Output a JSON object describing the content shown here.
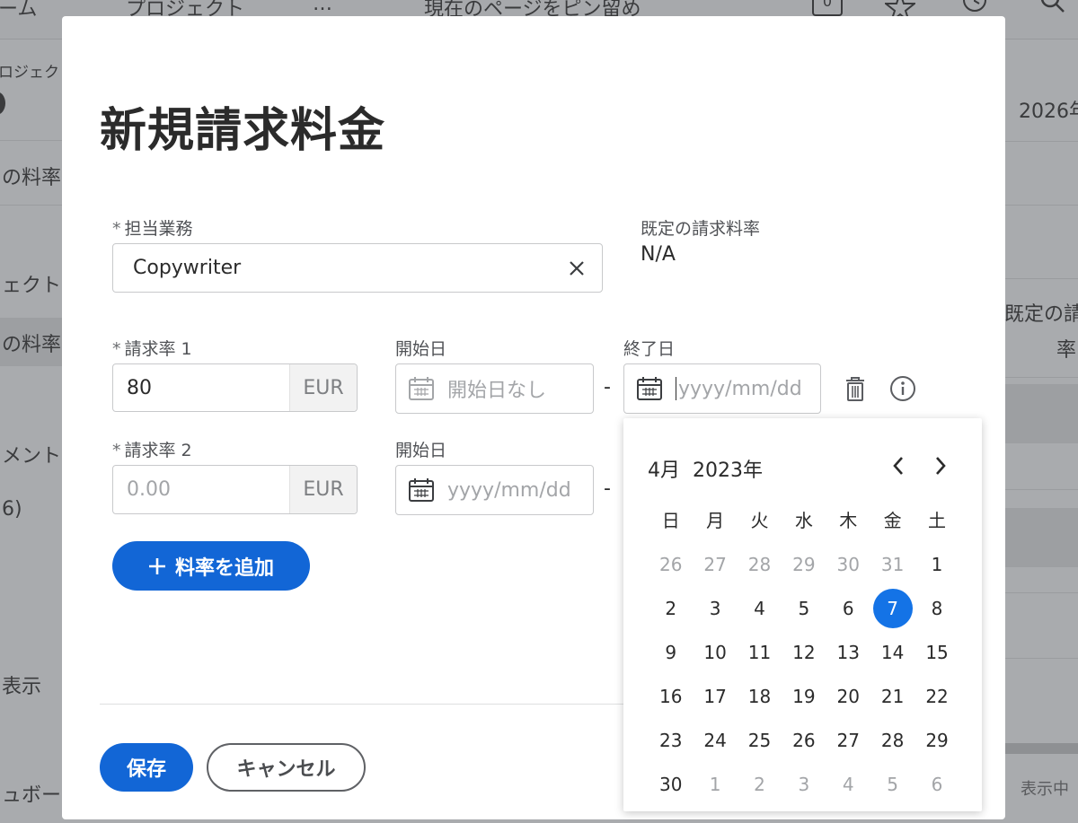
{
  "background": {
    "top_nav": [
      "ーム",
      "プロジェクト",
      "…",
      "現在のページをピン留め"
    ],
    "notification_count": "0",
    "left_texts": [
      "ロジェクト",
      "の料率",
      "ェクト",
      "の料率",
      "メント",
      "6)",
      "表示",
      "ュボー"
    ],
    "right_texts": [
      "2026年",
      "既定の請",
      "率",
      "表示中"
    ]
  },
  "modal": {
    "title": "新規請求料金",
    "role_label": "担当業務",
    "role_value": "Copywriter",
    "default_rate_label": "既定の請求料率",
    "default_rate_value": "N/A",
    "required_mark": "*",
    "rates": [
      {
        "label": "請求率 1",
        "value": "80",
        "placeholder": "",
        "currency": "EUR",
        "start_label": "開始日",
        "start_value": "開始日なし",
        "end_label": "終了日",
        "end_placeholder": "yyyy/mm/dd"
      },
      {
        "label": "請求率 2",
        "value": "",
        "placeholder": "0.00",
        "currency": "EUR",
        "start_label": "開始日",
        "start_placeholder": "yyyy/mm/dd"
      }
    ],
    "date_separator": "-",
    "add_rate_button": "料率を追加",
    "save_button": "保存",
    "cancel_button": "キャンセル"
  },
  "calendar": {
    "month": "4月",
    "year": "2023年",
    "weekdays": [
      "日",
      "月",
      "火",
      "水",
      "木",
      "金",
      "土"
    ],
    "weeks": [
      [
        "26",
        "27",
        "28",
        "29",
        "30",
        "31",
        "1"
      ],
      [
        "2",
        "3",
        "4",
        "5",
        "6",
        "7",
        "8"
      ],
      [
        "9",
        "10",
        "11",
        "12",
        "13",
        "14",
        "15"
      ],
      [
        "16",
        "17",
        "18",
        "19",
        "20",
        "21",
        "22"
      ],
      [
        "23",
        "24",
        "25",
        "26",
        "27",
        "28",
        "29"
      ],
      [
        "30",
        "1",
        "2",
        "3",
        "4",
        "5",
        "6"
      ]
    ],
    "selected_day": "7"
  },
  "colors": {
    "primary": "#1266d6",
    "selected_day": "#1473e6"
  }
}
